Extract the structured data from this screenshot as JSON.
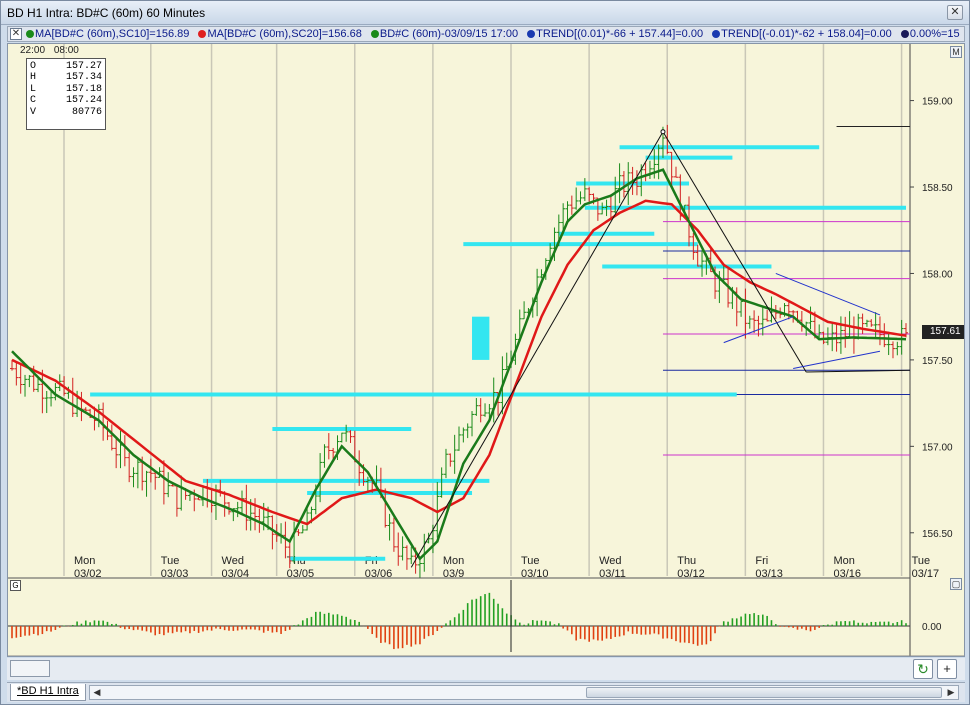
{
  "window": {
    "title": "BD H1 Intra: BD#C (60m) 60 Minutes",
    "close_label": "✕"
  },
  "studybar": {
    "close_label": "✕",
    "items": [
      {
        "text": "MA[BD#C (60m),SC10]=156.89",
        "color": "#1a8a1a"
      },
      {
        "text": "MA[BD#C (60m),SC20]=156.68",
        "color": "#e02020"
      },
      {
        "text": "BD#C (60m)-03/09/15 17:00",
        "color": "#1a8a1a"
      },
      {
        "text": "TREND[(0.01)*-66 + 157.44]=0.00",
        "color": "#1a3ab0"
      },
      {
        "text": "TREND[(-0.01)*-62 + 158.04]=0.00",
        "color": "#1a3ab0"
      },
      {
        "text": "0.00%=15",
        "color": "#1a1a5a"
      }
    ]
  },
  "top_controls": {
    "time_a": "22:00",
    "time_b": "08:00",
    "max_label": "M"
  },
  "ohlc": [
    {
      "k": "O",
      "v": "157.27"
    },
    {
      "k": "H",
      "v": "157.34"
    },
    {
      "k": "L",
      "v": "157.18"
    },
    {
      "k": "C",
      "v": "157.24"
    },
    {
      "k": "V",
      "v": "80776"
    }
  ],
  "last_price": "157.61",
  "indicator": {
    "toggle_label": "G",
    "max_label": "▢",
    "zero_label": "0.00"
  },
  "chart_data": {
    "type": "candlestick",
    "y_ticks": [
      "159.00",
      "158.50",
      "158.00",
      "157.50",
      "157.00",
      "156.50"
    ],
    "y_range": [
      156.25,
      159.2
    ],
    "day_labels": [
      {
        "d": "Mon",
        "date": "03/02"
      },
      {
        "d": "Tue",
        "date": "03/03"
      },
      {
        "d": "Wed",
        "date": "03/04"
      },
      {
        "d": "Thu",
        "date": "03/05"
      },
      {
        "d": "Fri",
        "date": "03/06"
      },
      {
        "d": "Mon",
        "date": "03/9"
      },
      {
        "d": "Tue",
        "date": "03/10"
      },
      {
        "d": "Wed",
        "date": "03/11"
      },
      {
        "d": "Thu",
        "date": "03/12"
      },
      {
        "d": "Fri",
        "date": "03/13"
      },
      {
        "d": "Mon",
        "date": "03/16"
      },
      {
        "d": "Tue",
        "date": "03/17"
      }
    ],
    "time_axis": [
      "03/03",
      "08:00",
      "08:00",
      "08:00",
      "08:00",
      "08:00",
      "08:00",
      "08:00",
      "08:00",
      "08:00",
      "08:00",
      "08:00",
      "08:00",
      "22"
    ],
    "close_anchors": [
      [
        0,
        157.45
      ],
      [
        6,
        157.35
      ],
      [
        12,
        157.3
      ],
      [
        16,
        157.2
      ],
      [
        20,
        157.15
      ],
      [
        26,
        156.9
      ],
      [
        32,
        156.85
      ],
      [
        38,
        156.7
      ],
      [
        44,
        156.75
      ],
      [
        50,
        156.68
      ],
      [
        56,
        156.6
      ],
      [
        60,
        156.5
      ],
      [
        64,
        156.4
      ],
      [
        68,
        156.55
      ],
      [
        72,
        156.95
      ],
      [
        76,
        157.1
      ],
      [
        80,
        156.9
      ],
      [
        84,
        156.75
      ],
      [
        88,
        156.45
      ],
      [
        92,
        156.3
      ],
      [
        96,
        156.45
      ],
      [
        100,
        156.9
      ],
      [
        104,
        157.1
      ],
      [
        108,
        157.25
      ],
      [
        112,
        157.3
      ],
      [
        116,
        157.6
      ],
      [
        120,
        157.9
      ],
      [
        124,
        158.2
      ],
      [
        128,
        158.4
      ],
      [
        132,
        158.45
      ],
      [
        136,
        158.35
      ],
      [
        140,
        158.5
      ],
      [
        144,
        158.55
      ],
      [
        148,
        158.7
      ],
      [
        150,
        158.82
      ],
      [
        154,
        158.4
      ],
      [
        158,
        158.1
      ],
      [
        162,
        157.95
      ],
      [
        166,
        157.85
      ],
      [
        170,
        157.7
      ],
      [
        174,
        157.7
      ],
      [
        178,
        157.85
      ],
      [
        182,
        157.75
      ],
      [
        186,
        157.6
      ],
      [
        190,
        157.62
      ],
      [
        194,
        157.68
      ],
      [
        198,
        157.66
      ],
      [
        202,
        157.64
      ],
      [
        206,
        157.62
      ]
    ],
    "ma10_anchors": [
      [
        0,
        157.55
      ],
      [
        10,
        157.3
      ],
      [
        20,
        157.15
      ],
      [
        28,
        156.95
      ],
      [
        36,
        156.8
      ],
      [
        44,
        156.7
      ],
      [
        52,
        156.62
      ],
      [
        58,
        156.55
      ],
      [
        64,
        156.45
      ],
      [
        70,
        156.75
      ],
      [
        76,
        157.0
      ],
      [
        82,
        156.85
      ],
      [
        88,
        156.6
      ],
      [
        94,
        156.35
      ],
      [
        98,
        156.45
      ],
      [
        104,
        156.9
      ],
      [
        110,
        157.15
      ],
      [
        116,
        157.55
      ],
      [
        122,
        157.95
      ],
      [
        128,
        158.3
      ],
      [
        132,
        158.4
      ],
      [
        138,
        158.45
      ],
      [
        144,
        158.55
      ],
      [
        150,
        158.6
      ],
      [
        156,
        158.3
      ],
      [
        162,
        158.0
      ],
      [
        168,
        157.85
      ],
      [
        174,
        157.8
      ],
      [
        180,
        157.75
      ],
      [
        186,
        157.62
      ],
      [
        194,
        157.63
      ],
      [
        206,
        157.62
      ]
    ],
    "ma20_anchors": [
      [
        0,
        157.5
      ],
      [
        10,
        157.38
      ],
      [
        20,
        157.2
      ],
      [
        30,
        157.0
      ],
      [
        40,
        156.8
      ],
      [
        50,
        156.72
      ],
      [
        60,
        156.62
      ],
      [
        68,
        156.55
      ],
      [
        76,
        156.7
      ],
      [
        84,
        156.75
      ],
      [
        92,
        156.7
      ],
      [
        98,
        156.62
      ],
      [
        104,
        156.7
      ],
      [
        110,
        156.95
      ],
      [
        116,
        157.35
      ],
      [
        122,
        157.75
      ],
      [
        128,
        158.05
      ],
      [
        134,
        158.25
      ],
      [
        140,
        158.35
      ],
      [
        146,
        158.42
      ],
      [
        152,
        158.4
      ],
      [
        158,
        158.25
      ],
      [
        164,
        158.05
      ],
      [
        170,
        157.95
      ],
      [
        176,
        157.88
      ],
      [
        182,
        157.8
      ],
      [
        188,
        157.72
      ],
      [
        196,
        157.68
      ],
      [
        206,
        157.64
      ]
    ],
    "cyan_levels": [
      {
        "y": 157.3,
        "x0": 18,
        "x1": 167
      },
      {
        "y": 157.1,
        "x0": 60,
        "x1": 92
      },
      {
        "y": 156.8,
        "x0": 44,
        "x1": 110
      },
      {
        "y": 156.73,
        "x0": 68,
        "x1": 106
      },
      {
        "y": 156.35,
        "x0": 64,
        "x1": 86
      },
      {
        "y": 158.17,
        "x0": 104,
        "x1": 158
      },
      {
        "y": 158.23,
        "x0": 126,
        "x1": 148
      },
      {
        "y": 158.04,
        "x0": 136,
        "x1": 175
      },
      {
        "y": 158.52,
        "x0": 130,
        "x1": 156
      },
      {
        "y": 158.38,
        "x0": 132,
        "x1": 206
      },
      {
        "y": 158.73,
        "x0": 140,
        "x1": 186
      },
      {
        "y": 158.67,
        "x0": 146,
        "x1": 166
      }
    ],
    "cyan_block": {
      "x0": 106,
      "x1": 110,
      "y0": 157.75,
      "y1": 157.5
    },
    "right_levels": [
      {
        "y": 158.85,
        "color": "#222222"
      },
      {
        "y": 158.3,
        "color": "#cc33cc"
      },
      {
        "y": 158.13,
        "color": "#1a2aa0"
      },
      {
        "y": 157.97,
        "color": "#cc33cc"
      },
      {
        "y": 157.65,
        "color": "#cc33cc"
      },
      {
        "y": 157.44,
        "color": "#1a2aa0"
      },
      {
        "y": 157.3,
        "color": "#1a2aa0"
      },
      {
        "y": 156.95,
        "color": "#cc33cc"
      }
    ],
    "histogram_anchors": [
      [
        0,
        -0.5
      ],
      [
        8,
        -0.3
      ],
      [
        14,
        0.1
      ],
      [
        20,
        0.3
      ],
      [
        26,
        -0.1
      ],
      [
        34,
        -0.4
      ],
      [
        40,
        -0.3
      ],
      [
        48,
        -0.15
      ],
      [
        56,
        -0.2
      ],
      [
        62,
        -0.35
      ],
      [
        66,
        0.1
      ],
      [
        70,
        0.6
      ],
      [
        76,
        0.5
      ],
      [
        80,
        0.2
      ],
      [
        84,
        -0.6
      ],
      [
        88,
        -1.0
      ],
      [
        94,
        -0.8
      ],
      [
        98,
        -0.2
      ],
      [
        102,
        0.4
      ],
      [
        106,
        1.2
      ],
      [
        110,
        1.5
      ],
      [
        114,
        0.6
      ],
      [
        118,
        0.1
      ],
      [
        122,
        0.3
      ],
      [
        126,
        0.05
      ],
      [
        130,
        -0.6
      ],
      [
        136,
        -0.7
      ],
      [
        142,
        -0.3
      ],
      [
        148,
        -0.4
      ],
      [
        156,
        -0.8
      ],
      [
        160,
        -0.9
      ],
      [
        164,
        0.2
      ],
      [
        170,
        0.6
      ],
      [
        174,
        0.4
      ],
      [
        178,
        -0.1
      ],
      [
        184,
        -0.2
      ],
      [
        188,
        0.05
      ],
      [
        192,
        0.3
      ],
      [
        196,
        0.1
      ],
      [
        206,
        0.2
      ]
    ]
  }
}
